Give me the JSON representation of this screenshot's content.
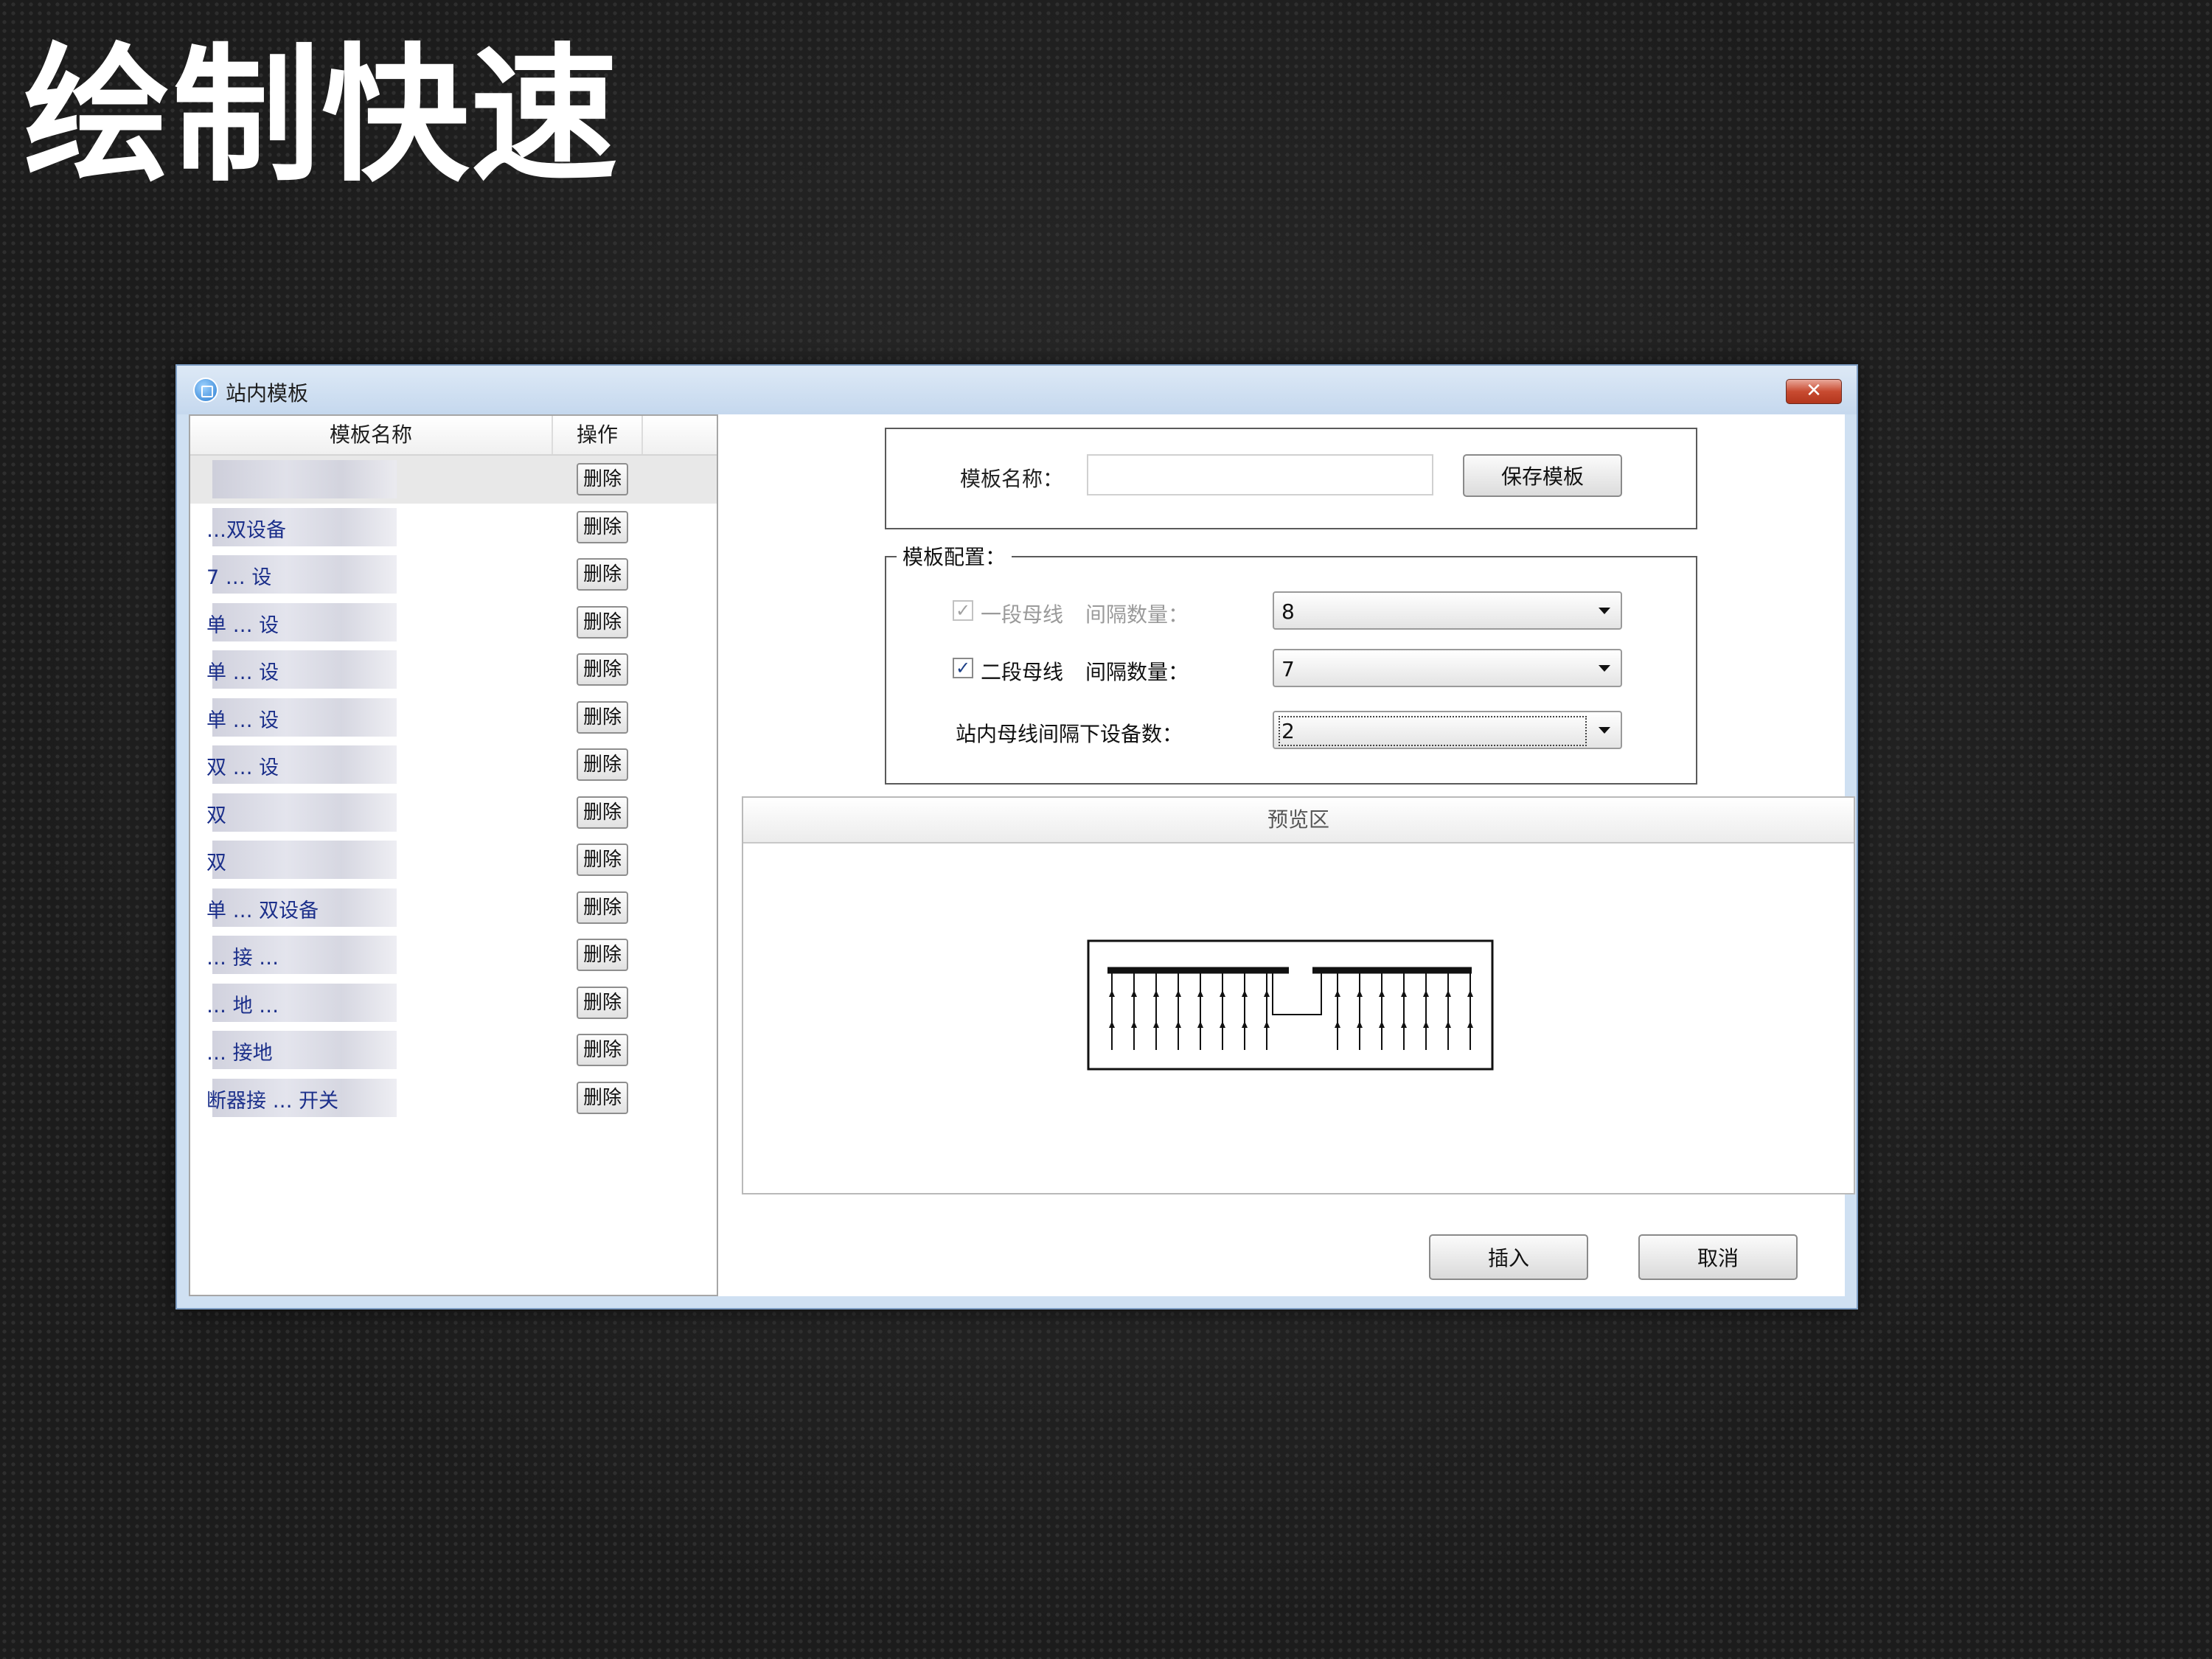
{
  "slide": {
    "title": "绘制快速"
  },
  "window": {
    "title": "站内模板",
    "close_label": "✕"
  },
  "template_list": {
    "headers": {
      "name": "模板名称",
      "operation": "操作"
    },
    "delete_label": "删除",
    "rows": [
      {
        "name": "",
        "blurred": true
      },
      {
        "name": "…双设备",
        "blurred": true
      },
      {
        "name": "7 … 设",
        "blurred": true
      },
      {
        "name": "单 … 设",
        "blurred": true
      },
      {
        "name": "单 … 设",
        "blurred": true
      },
      {
        "name": "单 … 设",
        "blurred": true
      },
      {
        "name": "双 … 设",
        "blurred": true
      },
      {
        "name": "双",
        "blurred": true
      },
      {
        "name": "双",
        "blurred": true
      },
      {
        "name": "单 … 双设备",
        "blurred": true
      },
      {
        "name": "… 接 …",
        "blurred": true
      },
      {
        "name": "… 地 …",
        "blurred": true
      },
      {
        "name": "… 接地",
        "blurred": true
      },
      {
        "name": "断器接 … 开关",
        "blurred": true
      }
    ]
  },
  "name_section": {
    "label": "模板名称：",
    "input_value": "",
    "save_label": "保存模板"
  },
  "config": {
    "legend": "模板配置：",
    "bus1": {
      "checked": true,
      "disabled": true,
      "label": "一段母线",
      "count_label": "间隔数量：",
      "value": "8"
    },
    "bus2": {
      "checked": true,
      "disabled": false,
      "label": "二段母线",
      "count_label": "间隔数量：",
      "value": "7"
    },
    "devices": {
      "label": "站内母线间隔下设备数：",
      "value": "2"
    },
    "check_glyph": "✓"
  },
  "preview": {
    "title": "预览区",
    "bus1_bays": 8,
    "bus2_bays": 7,
    "devices_per_bay": 2
  },
  "actions": {
    "insert_label": "插入",
    "cancel_label": "取消"
  }
}
